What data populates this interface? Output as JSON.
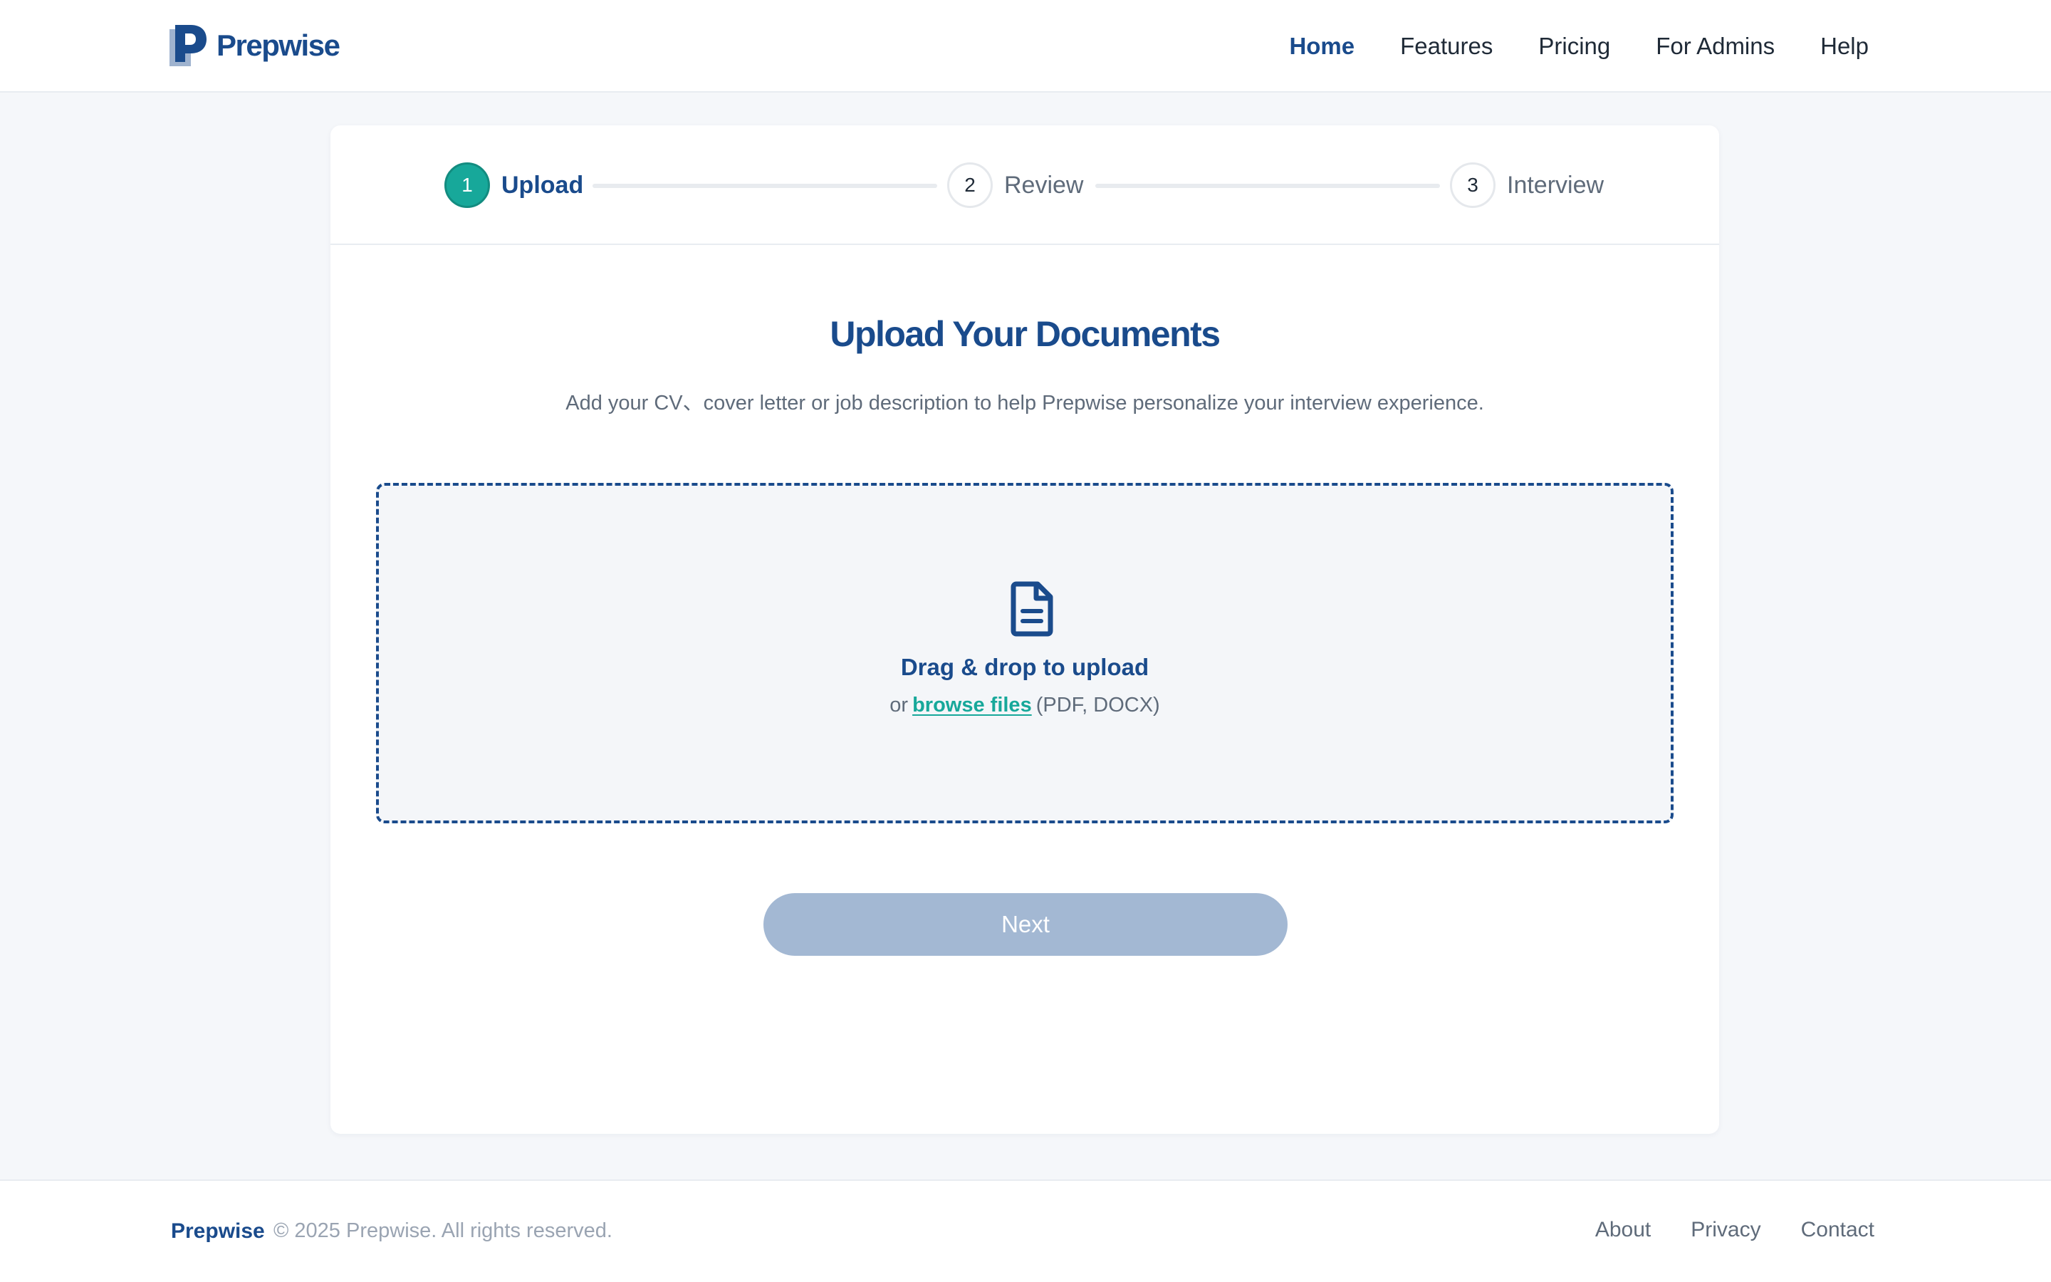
{
  "header": {
    "brand": "Prepwise",
    "nav": [
      {
        "label": "Home",
        "active": true
      },
      {
        "label": "Features",
        "active": false
      },
      {
        "label": "Pricing",
        "active": false
      },
      {
        "label": "For Admins",
        "active": false
      },
      {
        "label": "Help",
        "active": false
      }
    ]
  },
  "stepper": {
    "steps": [
      {
        "number": "1",
        "label": "Upload",
        "active": true
      },
      {
        "number": "2",
        "label": "Review",
        "active": false
      },
      {
        "number": "3",
        "label": "Interview",
        "active": false
      }
    ]
  },
  "main": {
    "title": "Upload Your Documents",
    "subtitle": "Add your CV、cover letter or job description to help Prepwise personalize your interview experience.",
    "dropzone": {
      "icon": "document-icon",
      "title": "Drag & drop to upload",
      "prefix": "or",
      "browse_label": "browse files",
      "formats": "(PDF, DOCX)"
    },
    "next_label": "Next"
  },
  "footer": {
    "brand": "Prepwise",
    "copyright": "© 2025 Prepwise. All rights reserved.",
    "links": [
      "About",
      "Privacy",
      "Contact"
    ]
  },
  "colors": {
    "brand_navy": "#1a4b8c",
    "accent_teal": "#17a89a",
    "disabled_button": "#a3b8d3",
    "page_background": "#f5f7fa"
  }
}
